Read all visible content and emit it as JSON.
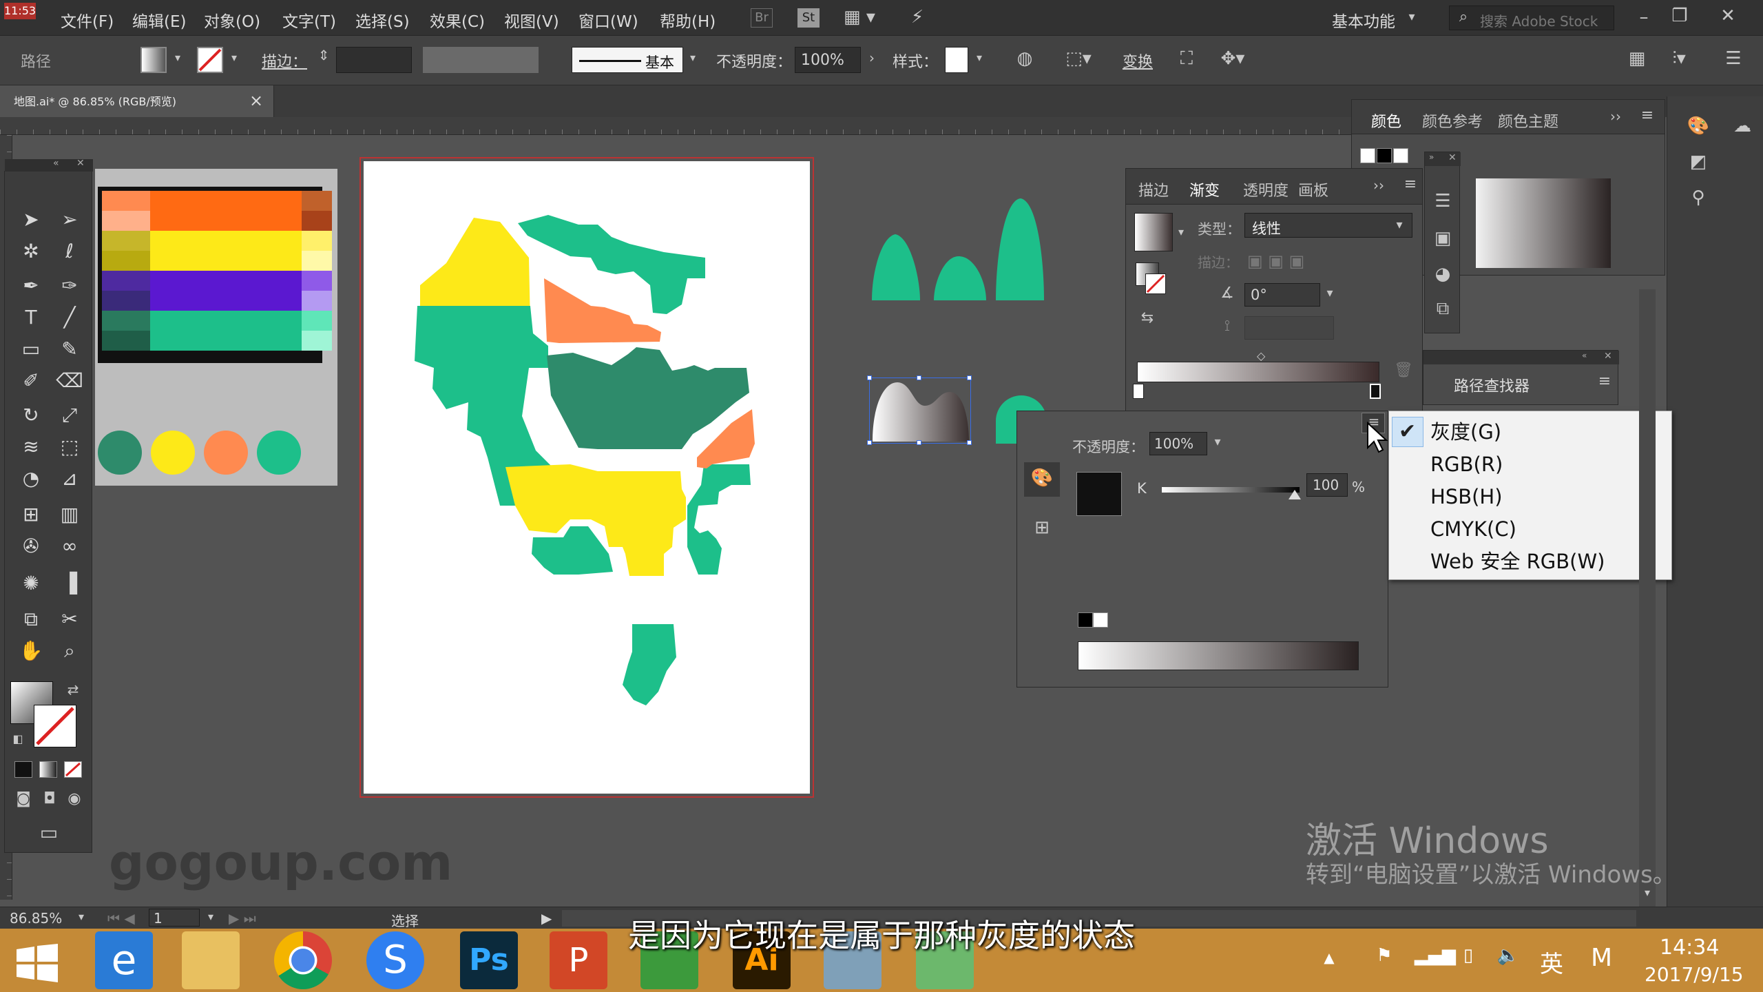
{
  "clock_top": "11:53",
  "menu": [
    "文件(F)",
    "编辑(E)",
    "对象(O)",
    "文字(T)",
    "选择(S)",
    "效果(C)",
    "视图(V)",
    "窗口(W)",
    "帮助(H)"
  ],
  "app_badges": {
    "br": "Br",
    "st": "St"
  },
  "workspace": "基本功能",
  "search_placeholder": "搜索 Adobe Stock",
  "control": {
    "object_type": "路径",
    "stroke_label": "描边：",
    "brush_label": "基本",
    "opacity_label": "不透明度：",
    "opacity_value": "100%",
    "style_label": "样式：",
    "transform_label": "变换"
  },
  "doc_tab": {
    "title": "地图.ai* @ 86.85% (RGB/预览)",
    "close": "×"
  },
  "color_panel": {
    "tabs": [
      "颜色",
      "颜色参考",
      "颜色主题"
    ]
  },
  "gradient_panel": {
    "tabs": [
      "描边",
      "渐变",
      "透明度",
      "画板"
    ],
    "type_label": "类型：",
    "type_value": "线性",
    "stroke_label": "描边：",
    "angle_value": "0°"
  },
  "gradient_stop_popup": {
    "opacity_label": "不透明度：",
    "opacity_value": "100%",
    "channel": "K",
    "value": "100",
    "unit": "%"
  },
  "pathfinder_panel": {
    "title": "路径查找器"
  },
  "colormode_menu": {
    "items": [
      "灰度(G)",
      "RGB(R)",
      "HSB(H)",
      "CMYK(C)",
      "Web 安全 RGB(W)"
    ],
    "checked_index": 0
  },
  "status": {
    "zoom": "86.85%",
    "page": "1",
    "tool": "选择"
  },
  "subtitle": "是因为它现在是属于那种灰度的状态",
  "watermark": {
    "line1": "激活 Windows",
    "line2": "转到“电脑设置”以激活 Windows。",
    "site": "gogoup.com"
  },
  "taskbar": {
    "lang": "英",
    "ime": "M",
    "time": "14:34",
    "date": "2017/9/15"
  },
  "colors": {
    "green": "#1dbf8a",
    "dark_green": "#2e8b6b",
    "yellow": "#fde918",
    "orange": "#ff8a50",
    "accent_red": "#c0392b"
  },
  "swatch_circles": [
    "#2e8b6b",
    "#fde918",
    "#ff8a50",
    "#1dbf8a"
  ],
  "swatch_grid": [
    [
      "#ff8a50",
      "#ff6a13",
      "#ff6a13",
      "#c0612b"
    ],
    [
      "#ffb08a",
      "#ff6a13",
      "#ff6a13",
      "#a8421a"
    ],
    [
      "#c6b62a",
      "#fde918",
      "#fde918",
      "#fff06a"
    ],
    [
      "#b8aa10",
      "#fde918",
      "#fde918",
      "#fff9a8"
    ],
    [
      "#4e2aa0",
      "#5b18d0",
      "#5b18d0",
      "#8f5ae8"
    ],
    [
      "#3a2a7a",
      "#5b18d0",
      "#5b18d0",
      "#b49af2"
    ],
    [
      "#2a7a5e",
      "#1dbf8a",
      "#1dbf8a",
      "#5fe6b8"
    ],
    [
      "#1f5e48",
      "#1dbf8a",
      "#1dbf8a",
      "#9ff5d6"
    ]
  ]
}
